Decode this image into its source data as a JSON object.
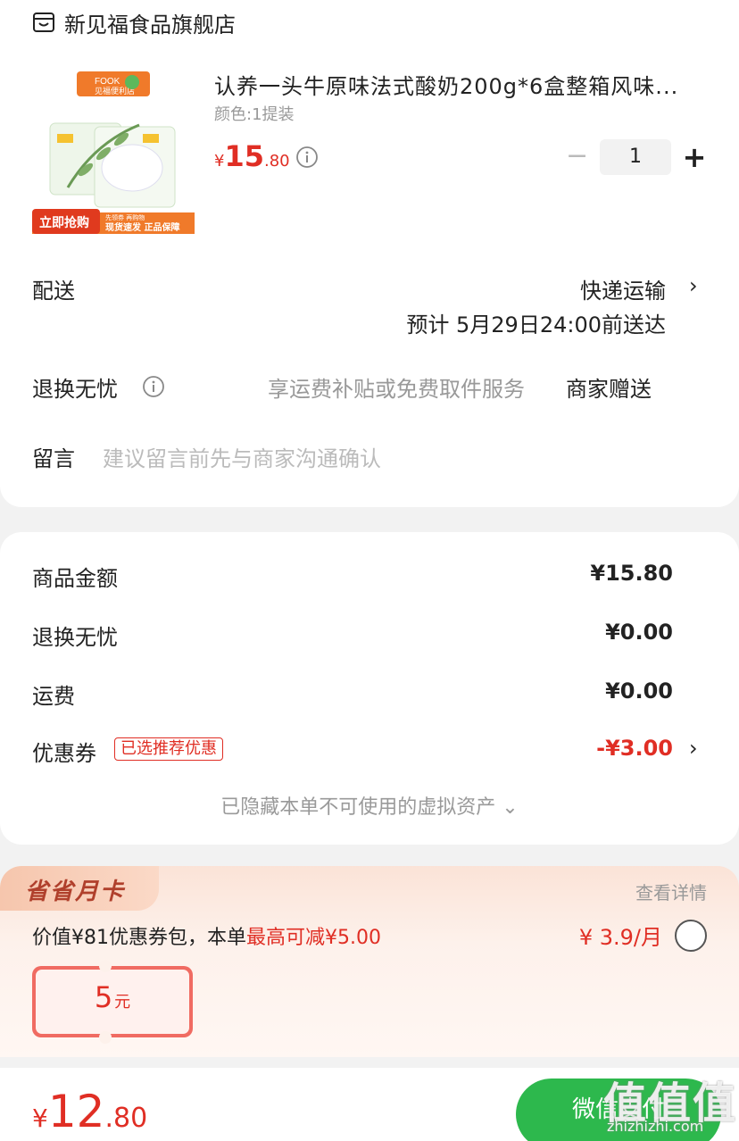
{
  "shop": {
    "name": "新见福食品旗舰店",
    "icon": "store-icon"
  },
  "product": {
    "image": {
      "badge_brand": "FOOK",
      "badge_store": "见福便利店",
      "cta": "立即抢购",
      "sub1": "先领券 再购物",
      "sub2": "现货速发 正品保障"
    },
    "title": "认养一头牛原味法式酸奶200g*6盒整箱风味...",
    "variant": "颜色:1提装",
    "price_currency": "¥",
    "price_int": "15",
    "price_dec": ".80",
    "quantity": "1",
    "minus": "−",
    "plus": "+"
  },
  "delivery": {
    "label": "配送",
    "method": "快递运输",
    "estimate": "预计 5月29日24:00前送达"
  },
  "returns": {
    "label": "退换无忧",
    "desc": "享运费补贴或免费取件服务",
    "tag": "商家赠送"
  },
  "note": {
    "label": "留言",
    "placeholder": "建议留言前先与商家沟通确认"
  },
  "amounts": {
    "goods_label": "商品金额",
    "goods_value": "¥15.80",
    "returns_label": "退换无忧",
    "returns_value": "¥0.00",
    "shipping_label": "运费",
    "shipping_value": "¥0.00",
    "coupon_label": "优惠券",
    "coupon_tag": "已选推荐优惠",
    "coupon_value": "-¥3.00",
    "hidden_note": "已隐藏本单不可使用的虚拟资产 ⌄"
  },
  "monthly_card": {
    "title": "省省月卡",
    "detail": "查看详情",
    "desc_prefix": "价值¥81优惠券包，本单",
    "desc_highlight": "最高可减¥5.00",
    "price": "¥ 3.9/月",
    "ticket_num": "5",
    "ticket_unit": "元"
  },
  "footer": {
    "total_currency": "¥",
    "total_int": "12",
    "total_dec": ".80",
    "pay_label": "微信支付",
    "watermark": "值值值",
    "watermark_url": "zhizhizhi.com"
  },
  "colors": {
    "accent": "#e02e24",
    "pay": "#2db84d"
  }
}
